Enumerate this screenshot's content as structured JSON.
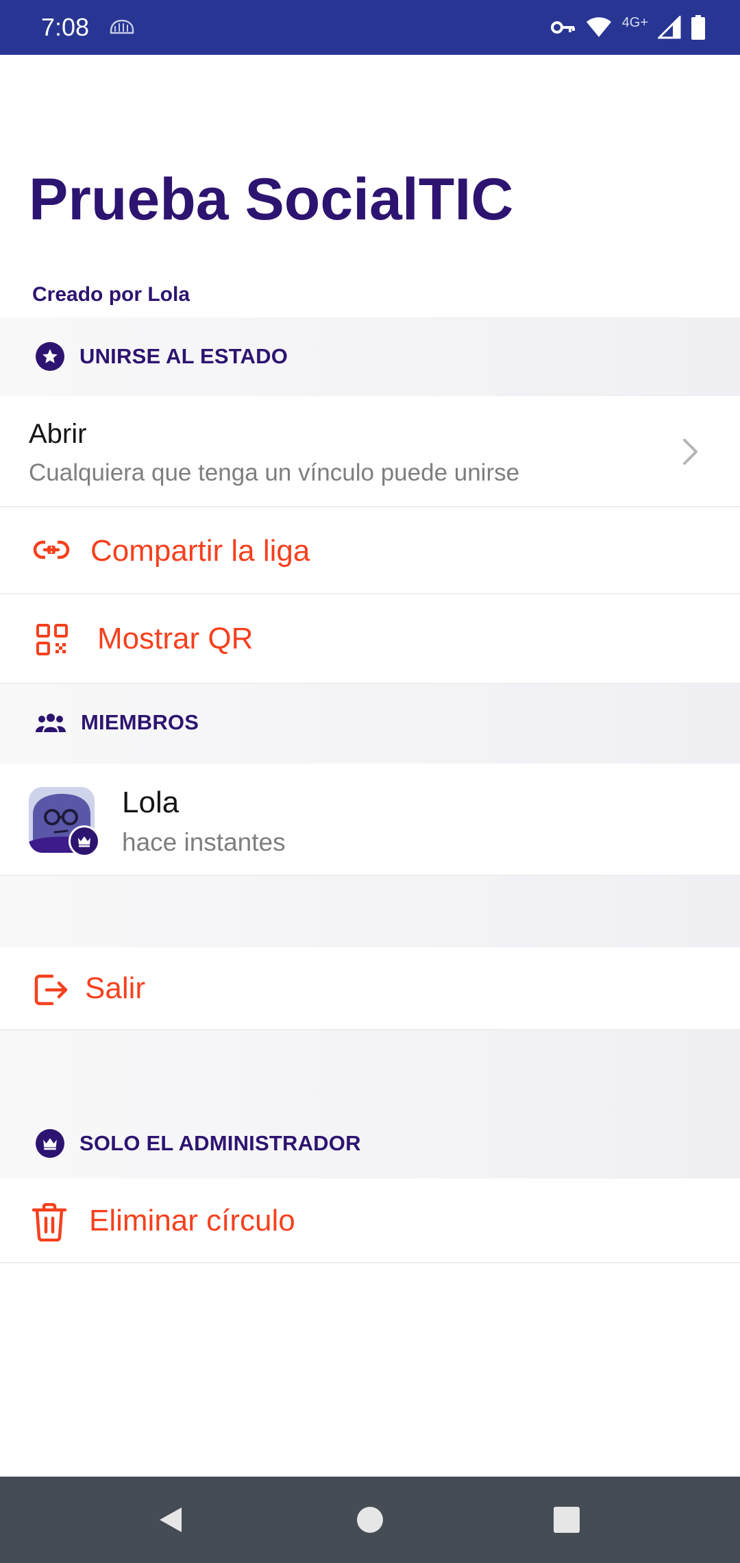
{
  "status_bar": {
    "time": "7:08",
    "network_label": "4G+",
    "left_icon": "hardware-chip-icon",
    "right_icons": [
      "vpn-key-icon",
      "wifi-icon",
      "signal-icon",
      "battery-icon"
    ]
  },
  "page": {
    "title": "Prueba SocialTIC",
    "created_by": "Creado por Lola"
  },
  "join_section": {
    "icon": "star-icon",
    "header": "UNIRSE AL ESTADO",
    "open_row": {
      "title": "Abrir",
      "description": "Cualquiera que tenga un vínculo puede unirse"
    },
    "share_label": "Compartir la liga",
    "share_icon": "link-icon",
    "qr_label": "Mostrar QR",
    "qr_icon": "qr-code-icon"
  },
  "members_section": {
    "icon": "people-icon",
    "header": "MIEMBROS",
    "members": [
      {
        "name": "Lola",
        "last_seen": "hace instantes",
        "badge": "crown-icon"
      }
    ]
  },
  "leave": {
    "label": "Salir",
    "icon": "exit-icon"
  },
  "admin_section": {
    "icon": "crown-icon",
    "header": "SOLO EL ADMINISTRADOR",
    "delete_label": "Eliminar círculo",
    "delete_icon": "trash-icon"
  },
  "nav_bar": {
    "buttons": [
      "back-icon",
      "home-icon",
      "recents-icon"
    ]
  },
  "colors": {
    "status_bar": "#283593",
    "primary": "#2d1470",
    "action": "#f5401e",
    "section_bg": "#f3f3f6",
    "nav_bar": "#454c54"
  }
}
